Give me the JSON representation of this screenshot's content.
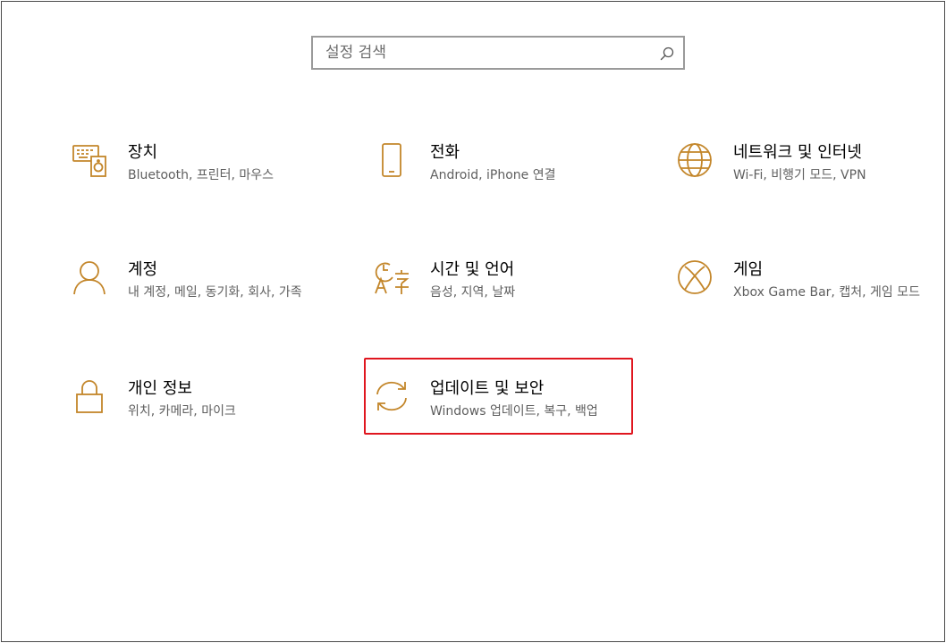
{
  "search": {
    "placeholder": "설정 검색",
    "icon": "search-icon"
  },
  "accent_color": "#c3862a",
  "highlight_color": "#e0161f",
  "tiles": [
    {
      "title": "장치",
      "desc": "Bluetooth, 프린터, 마우스",
      "icon": "devices-icon"
    },
    {
      "title": "전화",
      "desc": "Android, iPhone 연결",
      "icon": "phone-icon"
    },
    {
      "title": "네트워크 및 인터넷",
      "desc": "Wi-Fi, 비행기 모드, VPN",
      "icon": "globe-icon"
    },
    {
      "title": "계정",
      "desc": "내 계정, 메일, 동기화, 회사, 가족",
      "icon": "person-icon"
    },
    {
      "title": "시간 및 언어",
      "desc": "음성, 지역, 날짜",
      "icon": "time-language-icon"
    },
    {
      "title": "게임",
      "desc": "Xbox Game Bar, 캡처, 게임 모드",
      "icon": "xbox-icon"
    },
    {
      "title": "개인 정보",
      "desc": "위치, 카메라, 마이크",
      "icon": "lock-icon"
    },
    {
      "title": "업데이트 및 보안",
      "desc": "Windows 업데이트, 복구, 백업",
      "icon": "sync-icon"
    }
  ]
}
